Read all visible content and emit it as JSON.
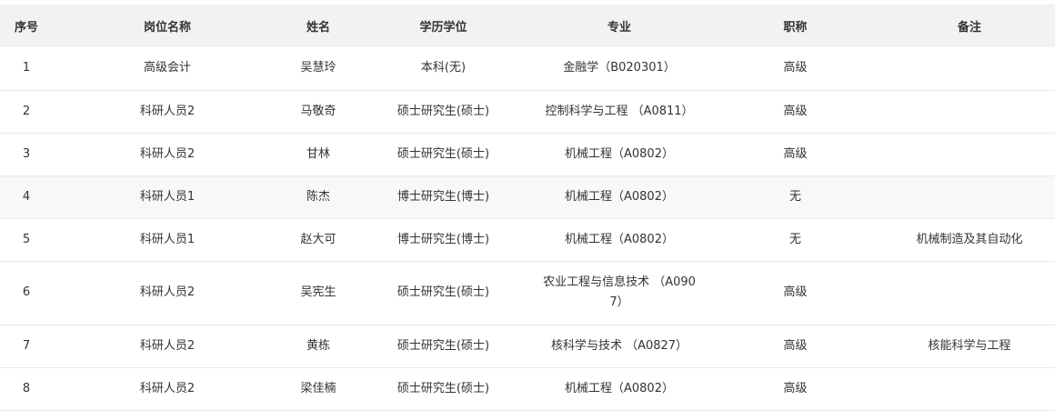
{
  "table": {
    "headers": {
      "idx": "序号",
      "position": "岗位名称",
      "name": "姓名",
      "degree": "学历学位",
      "major": "专业",
      "title": "职称",
      "note": "备注"
    },
    "rows": [
      {
        "idx": "1",
        "position": "高级会计",
        "name": "吴慧玲",
        "degree": "本科(无)",
        "major": "金融学（B020301）",
        "title": "高级",
        "note": ""
      },
      {
        "idx": "2",
        "position": "科研人员2",
        "name": "马敬奇",
        "degree": "硕士研究生(硕士)",
        "major": "控制科学与工程 （A0811）",
        "title": "高级",
        "note": ""
      },
      {
        "idx": "3",
        "position": "科研人员2",
        "name": "甘林",
        "degree": "硕士研究生(硕士)",
        "major": "机械工程（A0802）",
        "title": "高级",
        "note": ""
      },
      {
        "idx": "4",
        "position": "科研人员1",
        "name": "陈杰",
        "degree": "博士研究生(博士)",
        "major": "机械工程（A0802）",
        "title": "无",
        "note": ""
      },
      {
        "idx": "5",
        "position": "科研人员1",
        "name": "赵大可",
        "degree": "博士研究生(博士)",
        "major": "机械工程（A0802）",
        "title": "无",
        "note": "机械制造及其自动化"
      },
      {
        "idx": "6",
        "position": "科研人员2",
        "name": "吴宪生",
        "degree": "硕士研究生(硕士)",
        "major": "农业工程与信息技术 （A0907）",
        "title": "高级",
        "note": ""
      },
      {
        "idx": "7",
        "position": "科研人员2",
        "name": "黄栋",
        "degree": "硕士研究生(硕士)",
        "major": "核科学与技术 （A0827）",
        "title": "高级",
        "note": "核能科学与工程"
      },
      {
        "idx": "8",
        "position": "科研人员2",
        "name": "梁佳楠",
        "degree": "硕士研究生(硕士)",
        "major": "机械工程（A0802）",
        "title": "高级",
        "note": ""
      }
    ]
  }
}
